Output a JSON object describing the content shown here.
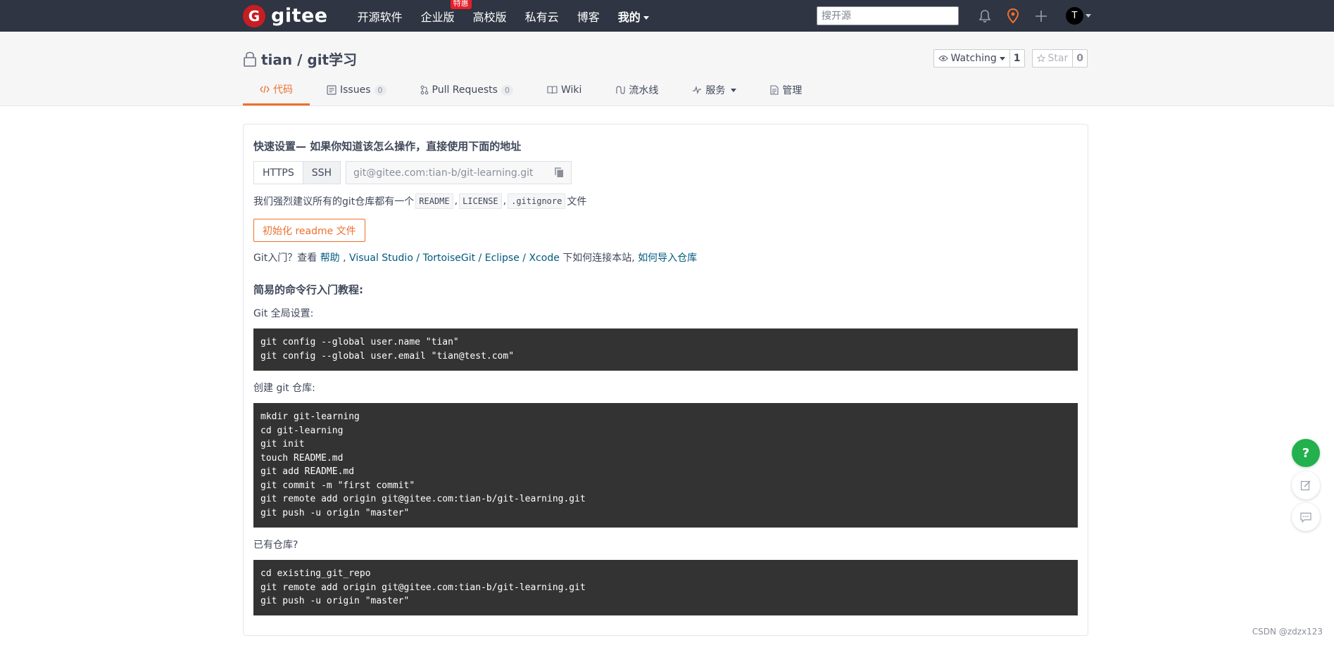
{
  "nav": {
    "logo_letter": "G",
    "logo_text": "gitee",
    "links": [
      {
        "label": "开源软件"
      },
      {
        "label": "企业版",
        "badge": "特惠"
      },
      {
        "label": "高校版"
      },
      {
        "label": "私有云"
      },
      {
        "label": "博客"
      },
      {
        "label": "我的"
      }
    ],
    "search_placeholder": "搜开源",
    "avatar_letter": "T"
  },
  "project": {
    "title": "tian / git学习",
    "watch_label": "Watching",
    "watch_count": "1",
    "star_label": "Star",
    "star_count": "0"
  },
  "tabs": [
    {
      "label": "代码"
    },
    {
      "label": "Issues",
      "count": "0"
    },
    {
      "label": "Pull Requests",
      "count": "0"
    },
    {
      "label": "Wiki"
    },
    {
      "label": "流水线"
    },
    {
      "label": "服务"
    },
    {
      "label": "管理"
    }
  ],
  "quick_setup": {
    "title": "快速设置— 如果你知道该怎么操作，直接使用下面的地址",
    "https_label": "HTTPS",
    "ssh_label": "SSH",
    "url": "git@gitee.com:tian-b/git-learning.git",
    "recommend_prefix": "我们强烈建议所有的git仓库都有一个",
    "recommend_files": [
      "README",
      "LICENSE",
      ".gitignore"
    ],
    "recommend_suffix": "文件",
    "init_button": "初始化 readme 文件",
    "intro_prefix": "Git入门？查看 ",
    "intro_help": "帮助",
    "intro_sep1": " , ",
    "intro_vs": "Visual Studio",
    "intro_slash1": " / ",
    "intro_tortoise": "TortoiseGit",
    "intro_slash2": " / ",
    "intro_eclipse": "Eclipse",
    "intro_slash3": " / ",
    "intro_xcode": "Xcode",
    "intro_mid": " 下如何连接本站, ",
    "intro_import": "如何导入仓库"
  },
  "tutorial": {
    "title": "简易的命令行入门教程:",
    "global_label": "Git 全局设置:",
    "global_code": "git config --global user.name \"tian\"\ngit config --global user.email \"tian@test.com\"",
    "create_label": "创建 git 仓库:",
    "create_code": "mkdir git-learning\ncd git-learning\ngit init\ntouch README.md\ngit add README.md\ngit commit -m \"first commit\"\ngit remote add origin git@gitee.com:tian-b/git-learning.git\ngit push -u origin \"master\"",
    "existing_label": "已有仓库?",
    "existing_code": "cd existing_git_repo\ngit remote add origin git@gitee.com:tian-b/git-learning.git\ngit push -u origin \"master\""
  },
  "floating": {
    "help_label": "?"
  },
  "watermark": "CSDN @zdzx123",
  "colors": {
    "brand": "#c71d23",
    "accent": "#f06f2c",
    "nav_bg": "#2f3542",
    "help_green": "#22b14c",
    "link": "#005980"
  }
}
